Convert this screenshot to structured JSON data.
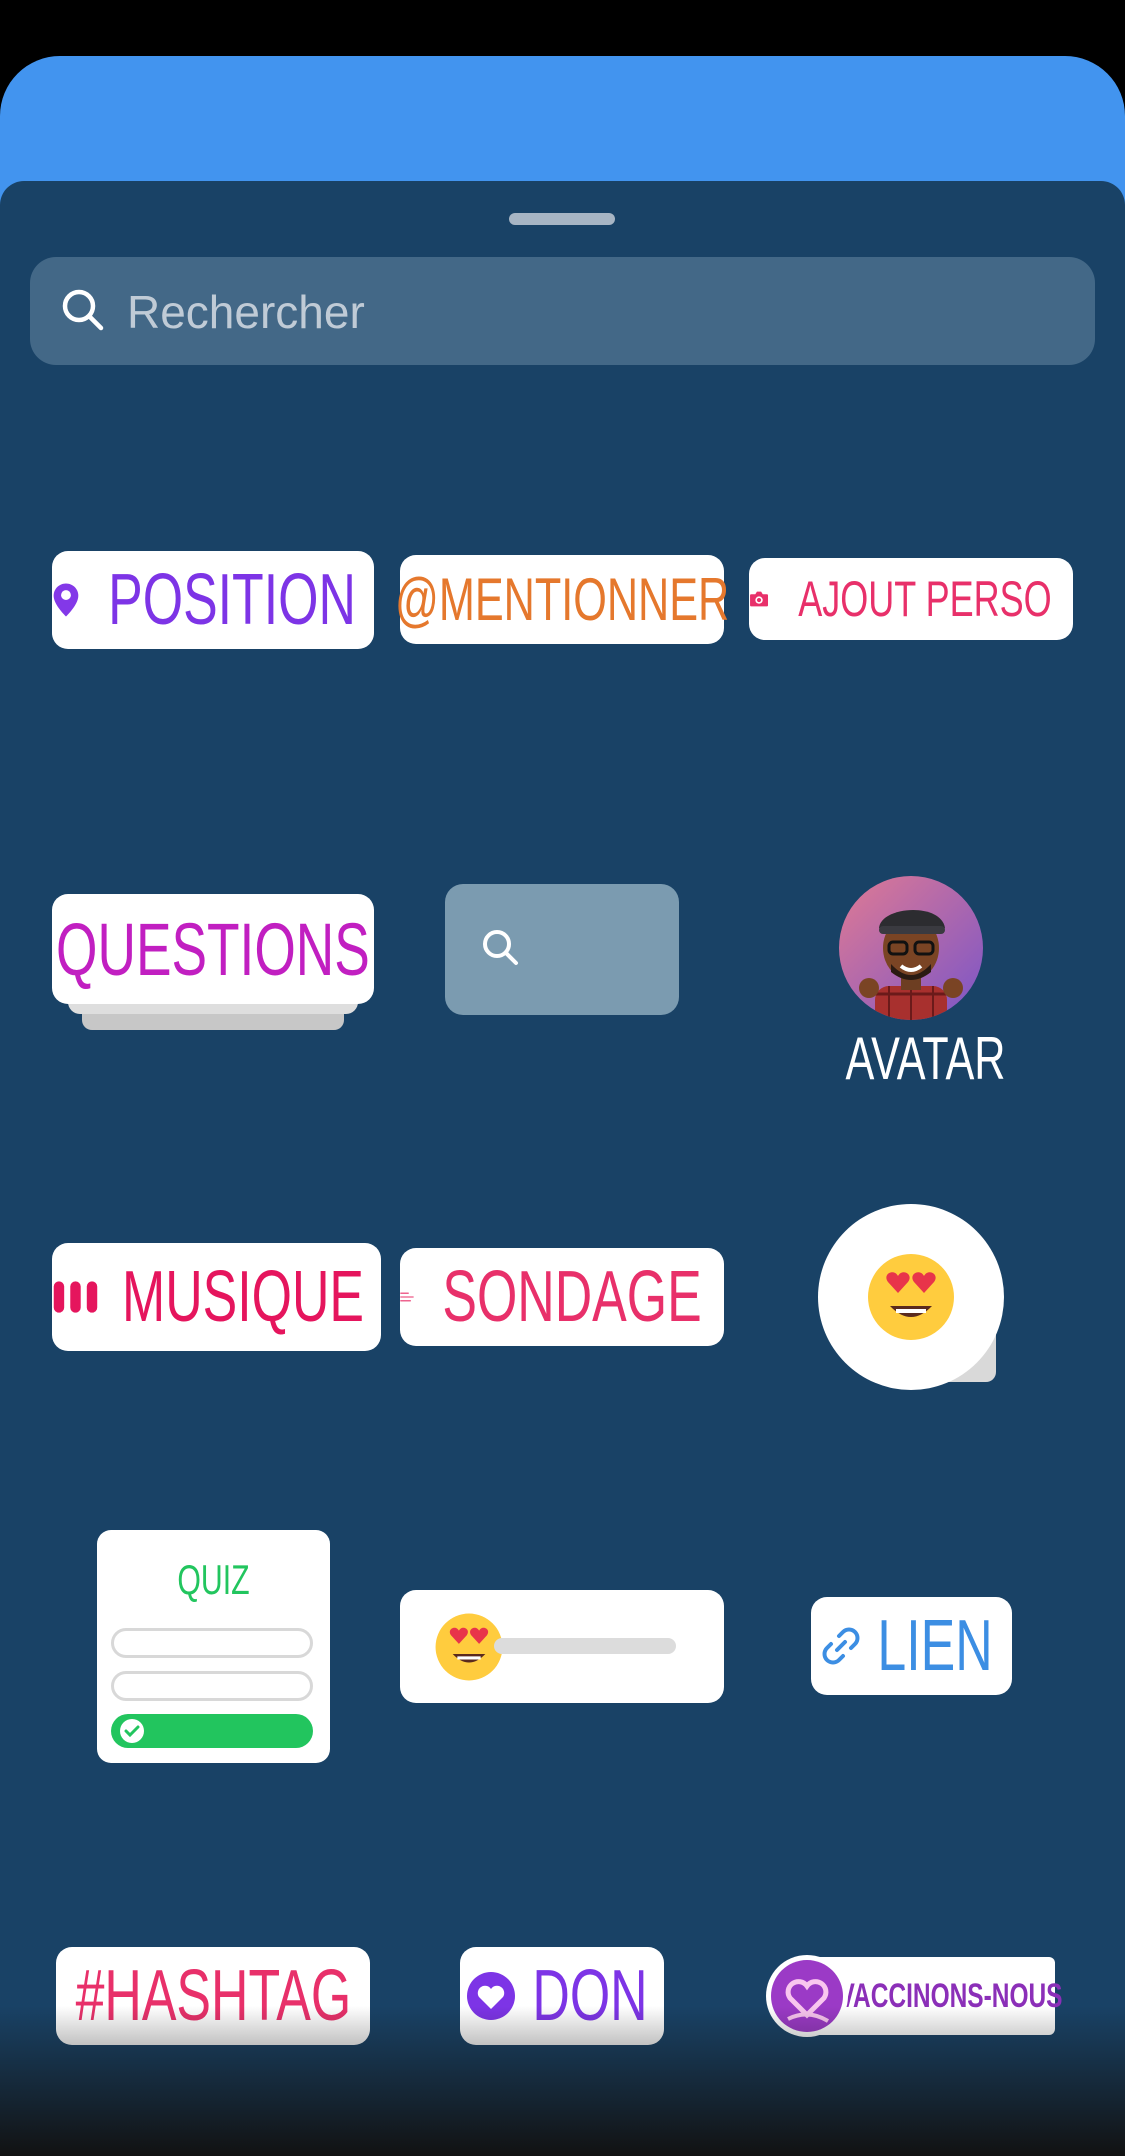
{
  "search": {
    "placeholder": "Rechercher"
  },
  "stickers": {
    "position": "POSITION",
    "mention": "@MENTIONNER",
    "custom": "AJOUT PERSO",
    "questions": "QUESTIONS",
    "avatar": "AVATAR",
    "music": "MUSIQUE",
    "poll": "SONDAGE",
    "quiz": "QUIZ",
    "link": "LIEN",
    "hashtag": "#HASHTAG",
    "donation": "DON",
    "vaccine": "VACCINONS-NOUS"
  },
  "emoji_slider": {
    "level": 0
  }
}
